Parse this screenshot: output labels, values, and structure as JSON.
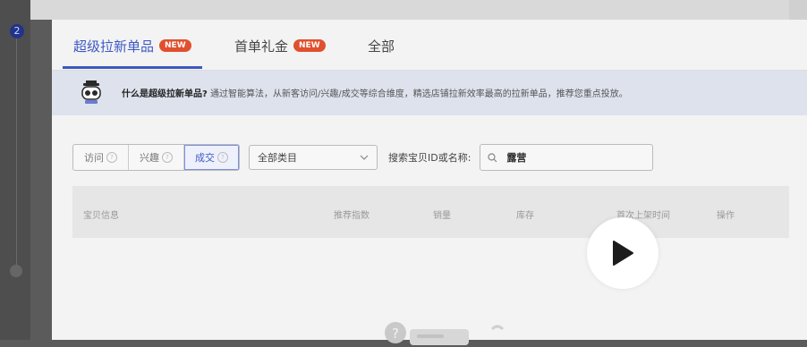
{
  "background": {
    "step_number": "2"
  },
  "tabs": [
    {
      "label": "超级拉新单品",
      "badge": "NEW",
      "active": true
    },
    {
      "label": "首单礼金",
      "badge": "NEW",
      "active": false
    },
    {
      "label": "全部",
      "badge": "",
      "active": false
    }
  ],
  "banner": {
    "question": "什么是超级拉新单品?",
    "text": "通过智能算法，从新客访问/兴趣/成交等综合维度，精选店铺拉新效率最高的拉新单品，推荐您重点投放。"
  },
  "filters": {
    "segments": [
      {
        "label": "访问",
        "active": false
      },
      {
        "label": "兴趣",
        "active": false
      },
      {
        "label": "成交",
        "active": true
      }
    ],
    "category": "全部类目",
    "search_label": "搜索宝贝ID或名称:",
    "search_value": "露营"
  },
  "table": {
    "headers": [
      "宝贝信息",
      "推荐指数",
      "销量",
      "库存",
      "首次上架时间",
      "操作"
    ]
  },
  "colors": {
    "accent": "#3f58c4",
    "badge": "#e0502e"
  }
}
